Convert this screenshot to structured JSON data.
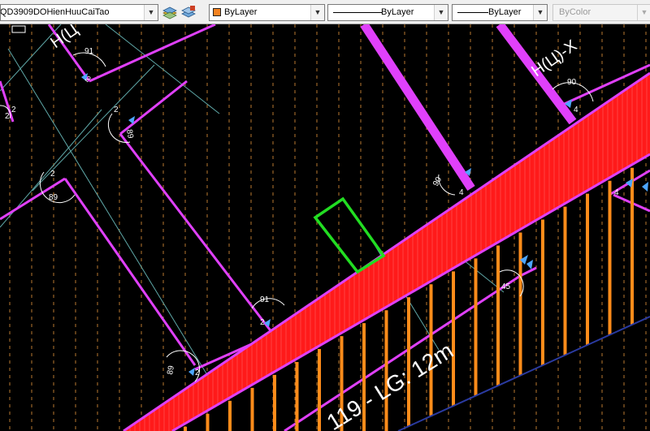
{
  "toolbar": {
    "layer_name": "QD3909DOHienHuuCaiTao",
    "color_value": "ByLayer",
    "color_swatch": "#f58220",
    "linetype_value": "ByLayer",
    "lineweight_value": "ByLayer",
    "plotstyle_value": "ByColor",
    "icons": [
      "layer-states-icon",
      "layer-properties-icon",
      "dropdown-arrow-icon"
    ]
  },
  "drawing": {
    "background": "#000000",
    "colors": {
      "road_fill": "#ff1a1a",
      "hatch_lines": "#ff8c1a",
      "boundary": "#e040fb",
      "selection": "#22dd22",
      "dashed_grid": "#d98c3a",
      "thin_lines": "#5fa8a8",
      "text": "#ffffff",
      "markers": "#4da6ff"
    },
    "road_label": "119 - LG: 12m",
    "corner_labels": [
      {
        "a": "91",
        "b": "2"
      },
      {
        "a": "89",
        "b": "2"
      },
      {
        "a": "89",
        "b": "2"
      },
      {
        "a": "90",
        "b": "4"
      },
      {
        "a": "90",
        "b": "4"
      },
      {
        "a": "91",
        "b": "2"
      },
      {
        "a": "89",
        "b": "2"
      },
      {
        "a": "45",
        "b": "4"
      },
      {
        "a": "2",
        "b": "2"
      }
    ],
    "top_label_left": "H(Ц",
    "top_label_right": "H(Ц)-X"
  }
}
